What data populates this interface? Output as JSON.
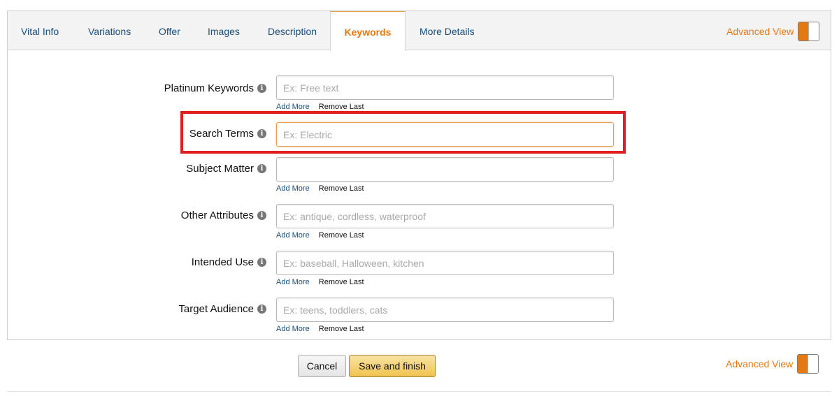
{
  "tabs": [
    {
      "label": "Vital Info"
    },
    {
      "label": "Variations"
    },
    {
      "label": "Offer"
    },
    {
      "label": "Images"
    },
    {
      "label": "Description"
    },
    {
      "label": "Keywords",
      "active": true
    },
    {
      "label": "More Details"
    }
  ],
  "advanced_view": {
    "label": "Advanced View",
    "state": "on"
  },
  "fields": [
    {
      "label": "Platinum Keywords",
      "placeholder": "Ex: Free text",
      "value": "",
      "has_links": true
    },
    {
      "label": "Search Terms",
      "placeholder": "Ex: Electric",
      "value": "",
      "has_links": false,
      "focused": true,
      "highlighted": true
    },
    {
      "label": "Subject Matter",
      "placeholder": "",
      "value": "",
      "has_links": true
    },
    {
      "label": "Other Attributes",
      "placeholder": "Ex: antique, cordless, waterproof",
      "value": "",
      "has_links": true
    },
    {
      "label": "Intended Use",
      "placeholder": "Ex: baseball, Halloween, kitchen",
      "value": "",
      "has_links": true
    },
    {
      "label": "Target Audience",
      "placeholder": "Ex: teens, toddlers, cats",
      "value": "",
      "has_links": true
    }
  ],
  "links": {
    "add_more": "Add More",
    "remove_last": "Remove Last"
  },
  "info_icon_glyph": "i",
  "buttons": {
    "cancel": "Cancel",
    "save": "Save and finish"
  },
  "colors": {
    "accent": "#e47911",
    "link": "#1a4e7a",
    "highlight": "#e02020",
    "save_button": "#f0c34f"
  }
}
